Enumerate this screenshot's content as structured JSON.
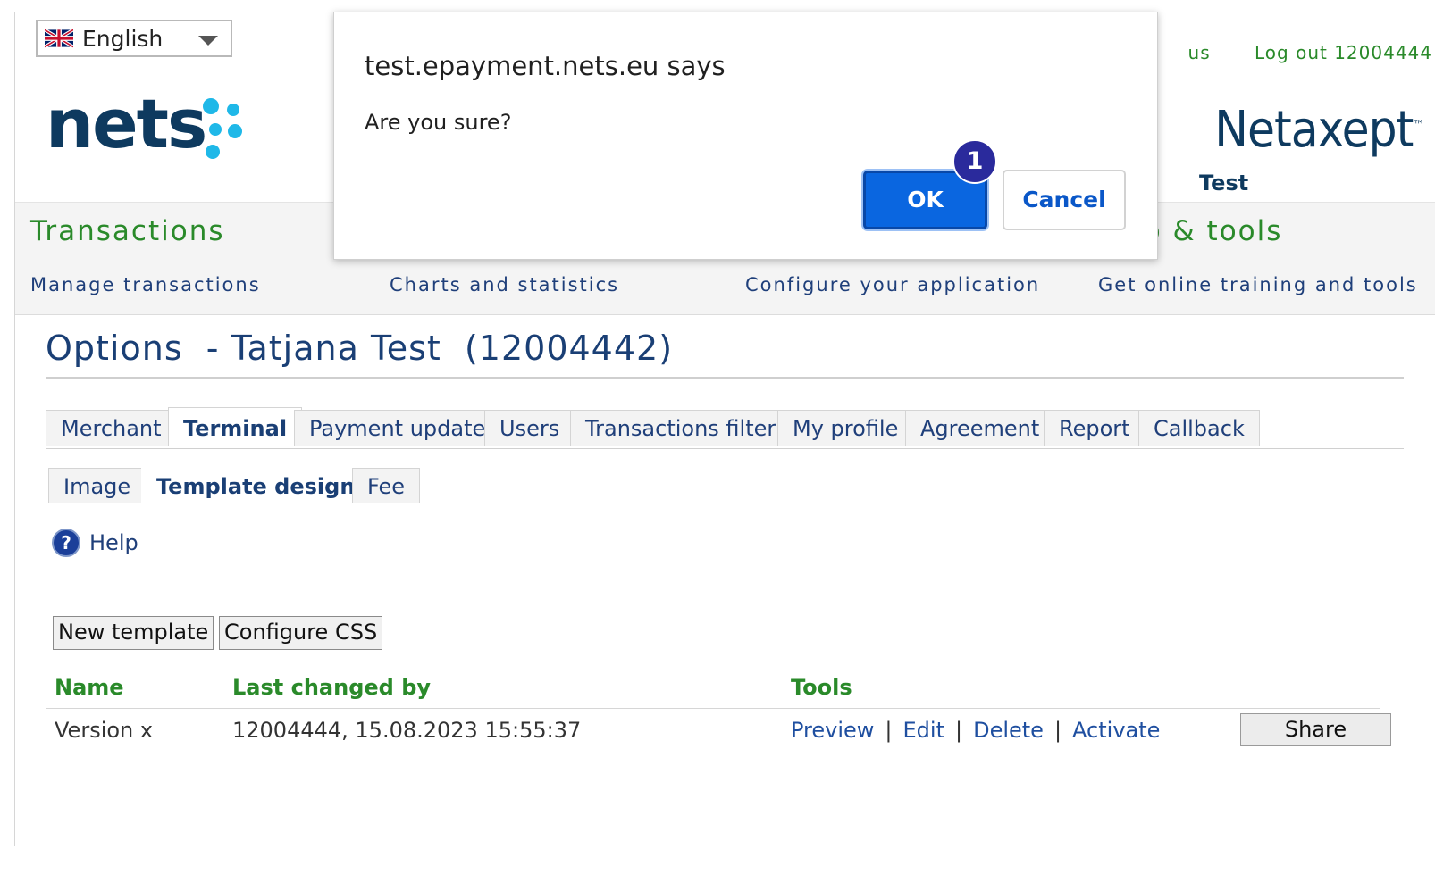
{
  "header": {
    "language": "English",
    "logo_text": "nets",
    "links": [
      "us",
      "Log out 12004444"
    ],
    "product": "Netaxept",
    "product_tm": "™",
    "environment": "Test"
  },
  "nav": [
    {
      "title": "Transactions",
      "subtitle": "Manage transactions"
    },
    {
      "title": "",
      "subtitle": "Charts and statistics"
    },
    {
      "title": "",
      "subtitle": "Configure your application"
    },
    {
      "title": "p & tools",
      "subtitle": "Get online training and tools"
    }
  ],
  "page_title": "Options  - Tatjana Test  (12004442)",
  "tabs": [
    "Merchant",
    "Terminal",
    "Payment update",
    "Users",
    "Transactions filter",
    "My profile",
    "Agreement",
    "Report",
    "Callback"
  ],
  "active_tab": "Terminal",
  "subtabs": [
    "Image",
    "Template design",
    "Fee"
  ],
  "active_subtab": "Template design",
  "help_label": "Help",
  "buttons": {
    "new_template": "New template",
    "configure_css": "Configure CSS"
  },
  "table": {
    "headers": {
      "name": "Name",
      "last_changed": "Last changed by",
      "tools": "Tools"
    },
    "rows": [
      {
        "name": "Version x",
        "last_changed": "12004444, 15.08.2023  15:55:37",
        "tools": [
          "Preview",
          "Edit",
          "Delete",
          "Activate"
        ],
        "share": "Share"
      }
    ]
  },
  "dialog": {
    "title": "test.epayment.nets.eu says",
    "message": "Are you sure?",
    "ok": "OK",
    "cancel": "Cancel",
    "step_badge": "1"
  },
  "colors": {
    "brand_navy": "#0e3a5f",
    "brand_cyan": "#1fb8e8",
    "green": "#2a8a2a",
    "link_blue": "#1f4fa0",
    "dialog_ok": "#0a66e0",
    "badge": "#2a2a9c"
  },
  "icons": {
    "flag": "uk-flag-icon",
    "help": "help-icon",
    "dropdown": "chevron-down-icon"
  }
}
